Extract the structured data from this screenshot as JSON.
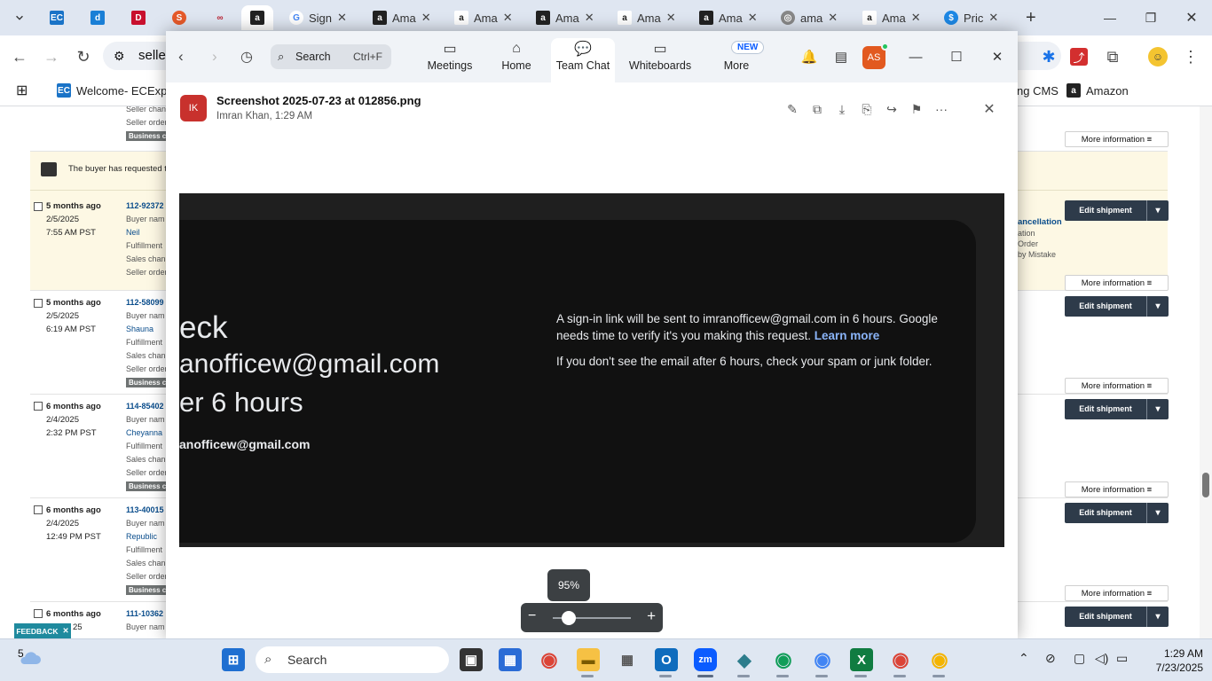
{
  "browser": {
    "tabs": [
      {
        "label": "",
        "icon": "ec-icon"
      },
      {
        "label": "",
        "icon": "blue-doc-icon"
      },
      {
        "label": "",
        "icon": "red-app-icon"
      },
      {
        "label": "",
        "icon": "swirl-icon"
      },
      {
        "label": "",
        "icon": "link-icon"
      },
      {
        "label": "",
        "icon": "amazon-icon"
      },
      {
        "label": "Sign",
        "icon": "google-icon"
      },
      {
        "label": "Ama",
        "icon": "amazon-icon"
      },
      {
        "label": "Ama",
        "icon": "amazon-icon"
      },
      {
        "label": "Ama",
        "icon": "amazon-icon"
      },
      {
        "label": "Ama",
        "icon": "amazon-icon"
      },
      {
        "label": "Ama",
        "icon": "amazon-icon"
      },
      {
        "label": "ama",
        "icon": "globe-icon"
      },
      {
        "label": "Ama",
        "icon": "amazon-icon"
      },
      {
        "label": "Pric",
        "icon": "dollar-icon"
      }
    ],
    "address": "seller",
    "bookmarks": {
      "welcome": "Welcome- ECExpres",
      "cms": "ng CMS",
      "amazon": "Amazon"
    }
  },
  "orders_page": {
    "notice": "The buyer has requested th",
    "top_lines": [
      "Seller chan",
      "Seller order",
      "Business cus"
    ],
    "rows": [
      {
        "age": "5 months ago",
        "date": "2/5/2025",
        "time": "7:55 AM PST",
        "order": "112-92372",
        "buyer_label": "Buyer nam",
        "buyer": "Neil",
        "fulfillment": "Fulfillment",
        "sales": "Sales chan",
        "seller": "Seller order",
        "badge": ""
      },
      {
        "age": "5 months ago",
        "date": "2/5/2025",
        "time": "6:19 AM PST",
        "order": "112-58099",
        "buyer_label": "Buyer nam",
        "buyer": "Shauna",
        "fulfillment": "Fulfillment",
        "sales": "Sales chan",
        "seller": "Seller order",
        "badge": "Business cus"
      },
      {
        "age": "6 months ago",
        "date": "2/4/2025",
        "time": "2:32 PM PST",
        "order": "114-85402",
        "buyer_label": "Buyer nam",
        "buyer": "Cheyanna",
        "fulfillment": "Fulfillment",
        "sales": "Sales chan",
        "seller": "Seller order",
        "badge": "Business cus"
      },
      {
        "age": "6 months ago",
        "date": "2/4/2025",
        "time": "12:49 PM PST",
        "order": "113-40015",
        "buyer_label": "Buyer nam",
        "buyer": "Republic",
        "fulfillment": "Fulfillment",
        "sales": "Sales chan",
        "seller": "Seller order",
        "badge": "Business cus"
      },
      {
        "age": "6 months ago",
        "date": "25",
        "time": "",
        "order": "111-10362",
        "buyer_label": "Buyer nam",
        "buyer": "",
        "fulfillment": "",
        "sales": "",
        "seller": "",
        "badge": ""
      }
    ],
    "more_info": "More information",
    "edit_shipment": "Edit shipment",
    "cancellation": {
      "title": "ancellation",
      "line1": "ation",
      "line2": "Order",
      "line3": "by Mistake"
    },
    "feedback": "FEEDBACK"
  },
  "zoom": {
    "search_placeholder": "Search",
    "search_shortcut": "Ctrl+F",
    "nav": {
      "meetings": "Meetings",
      "home": "Home",
      "team_chat": "Team Chat",
      "whiteboards": "Whiteboards",
      "more": "More",
      "new_badge": "NEW"
    },
    "avatar": "AS",
    "file": {
      "avatar": "IK",
      "name": "Screenshot 2025-07-23 at 012856.png",
      "meta": "Imran Khan, 1:29 AM"
    },
    "image_text": {
      "heading1": "eck",
      "heading2": "anofficew@gmail.com",
      "heading3": "er 6 hours",
      "email": "anofficew@gmail.com",
      "para1": "A sign-in link will be sent to imranofficew@gmail.com in 6 hours. Google needs time to verify it's you making this request.",
      "learn_more": "Learn more",
      "para2": "If you don't see the email after 6 hours, check your spam or junk folder."
    },
    "zoom_level": "95%",
    "zoom_fraction": 0.2
  },
  "taskbar": {
    "search": "Search",
    "weather_badge": "5",
    "time": "1:29 AM",
    "date": "7/23/2025"
  },
  "colors": {
    "zoom_accent": "#0b5cff",
    "edit_button": "#2e3b4a",
    "order_link": "#0a4d8c",
    "row_highlight": "#fdf8e4"
  }
}
